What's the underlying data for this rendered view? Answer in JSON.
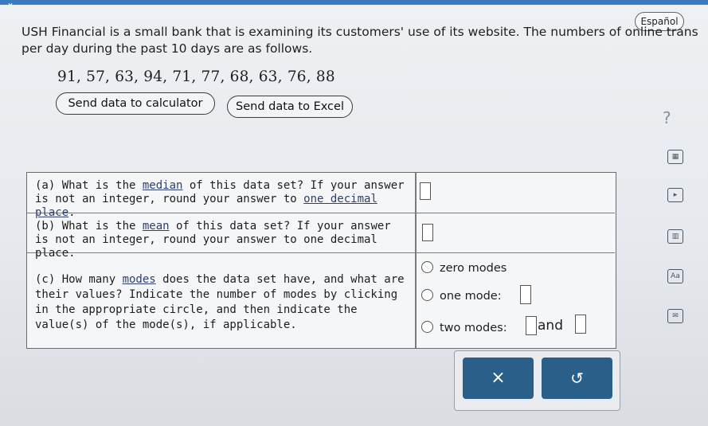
{
  "language_button": "Español",
  "intro": {
    "line1": "USH Financial is a small bank that is examining its customers' use of its website. The numbers of online trans",
    "line2": "per day during the past 10 days are as follows."
  },
  "data_values": "91, 57, 63, 94, 71, 77, 68, 63, 76, 88",
  "buttons": {
    "send_calculator": "Send data to calculator",
    "send_excel": "Send data to Excel"
  },
  "help_symbol": "?",
  "questions": {
    "a": {
      "pre": "(a) What is the ",
      "link1": "median",
      "mid": " of this data set? If your answer is not an integer, round your answer to ",
      "link2": "one decimal place",
      "post": "."
    },
    "b": {
      "pre": "(b) What is the ",
      "link1": "mean",
      "post": " of this data set? If your answer is not an integer, round your answer to one decimal place."
    },
    "c": {
      "pre": "(c) How many ",
      "link1": "modes",
      "post": " does the data set have, and what are their values? Indicate the number of modes by clicking in the appropriate circle, and then indicate the value(s) of the mode(s), if applicable."
    }
  },
  "options": {
    "zero": "zero modes",
    "one": "one mode:",
    "two": "two modes:",
    "and": "and"
  },
  "actions": {
    "clear": "×",
    "undo": "↺"
  },
  "tools": {
    "calculator": "▦",
    "play": "▸",
    "book": "▥",
    "text": "Aa",
    "mail": "✉"
  }
}
